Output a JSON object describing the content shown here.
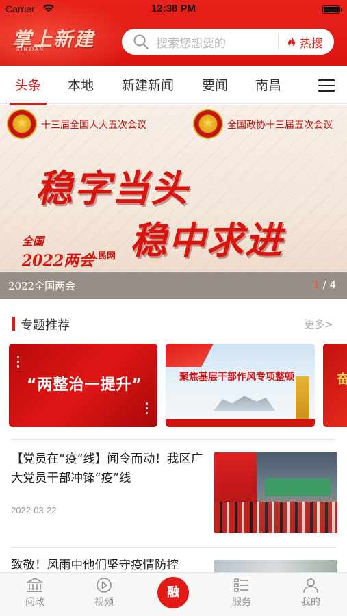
{
  "status_bar": {
    "carrier": "Carrier",
    "time": "12:38 PM"
  },
  "header": {
    "logo_text": "掌上新建",
    "logo_sub": "XINJIAN",
    "search_placeholder": "搜索您想要的",
    "hot_search_label": "热搜",
    "accent_color": "#e21b16"
  },
  "tabs": [
    {
      "label": "头条",
      "active": true
    },
    {
      "label": "本地",
      "active": false
    },
    {
      "label": "新建新闻",
      "active": false
    },
    {
      "label": "要闻",
      "active": false
    },
    {
      "label": "南昌",
      "active": false
    }
  ],
  "banner": {
    "left_conference": "十三届全国人大五次会议",
    "right_conference": "全国政协十三届五次会议",
    "slogan_line1": "稳字当头",
    "slogan_line2": "稳中求进",
    "badge_top": "全国",
    "badge_bottom": "2022两会",
    "source": "人民网",
    "caption": "2022全国两会",
    "page_current": "1",
    "page_total": "/ 4"
  },
  "topics": {
    "title": "专题推荐",
    "more_label": "更多>",
    "cards": [
      {
        "title": "“两整治一提升”"
      },
      {
        "title": "聚焦基层干部作风专项整顿"
      },
      {
        "title": "奋"
      }
    ]
  },
  "news": [
    {
      "title": "【党员在“疫”线】闻令而动！我区广大党员干部冲锋“疫”线",
      "date": "2022-03-22"
    },
    {
      "title": "致敬！风雨中他们坚守疫情防控",
      "date": ""
    }
  ],
  "tabbar": {
    "items": [
      {
        "label": "问政",
        "icon": "building-icon"
      },
      {
        "label": "视频",
        "icon": "play-icon"
      },
      {
        "label": "融",
        "icon": "rong-center-icon"
      },
      {
        "label": "服务",
        "icon": "service-list-icon"
      },
      {
        "label": "我的",
        "icon": "person-icon"
      }
    ]
  }
}
